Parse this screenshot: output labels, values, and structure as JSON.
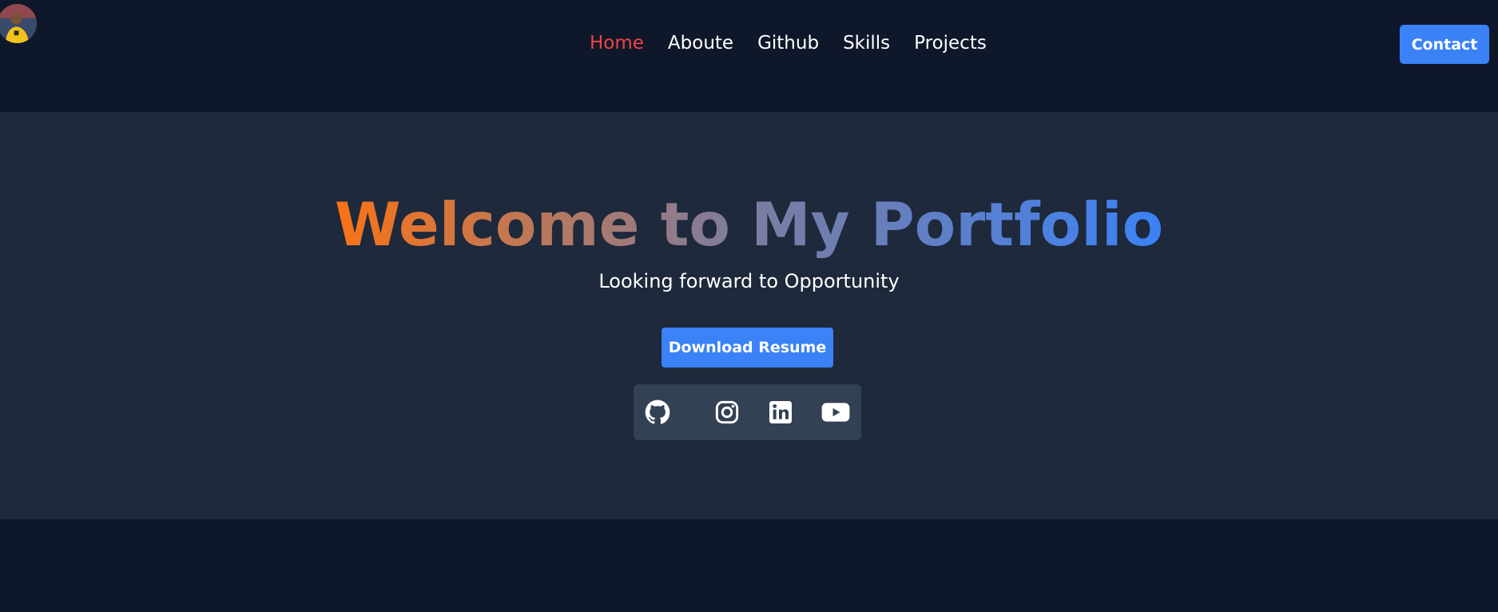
{
  "header": {
    "avatar_alt": "profile photo",
    "nav": [
      {
        "label": "Home",
        "active": true
      },
      {
        "label": "Aboute",
        "active": false
      },
      {
        "label": "Github",
        "active": false
      },
      {
        "label": "Skills",
        "active": false
      },
      {
        "label": "Projects",
        "active": false
      }
    ],
    "contact_label": "Contact"
  },
  "hero": {
    "title": "Welcome to My Portfolio",
    "subtitle": "Looking forward to Opportunity",
    "resume_label": "Download Resume",
    "social_icons": [
      "github-icon",
      "instagram-icon",
      "linkedin-icon",
      "youtube-icon"
    ]
  },
  "colors": {
    "page_bg": "#0f172a",
    "hero_bg": "#1e293b",
    "social_bar_bg": "#334155",
    "accent_blue": "#3b82f6",
    "active_nav": "#ef4444",
    "title_gradient_start": "#f97316",
    "title_gradient_end": "#3b82f6"
  }
}
